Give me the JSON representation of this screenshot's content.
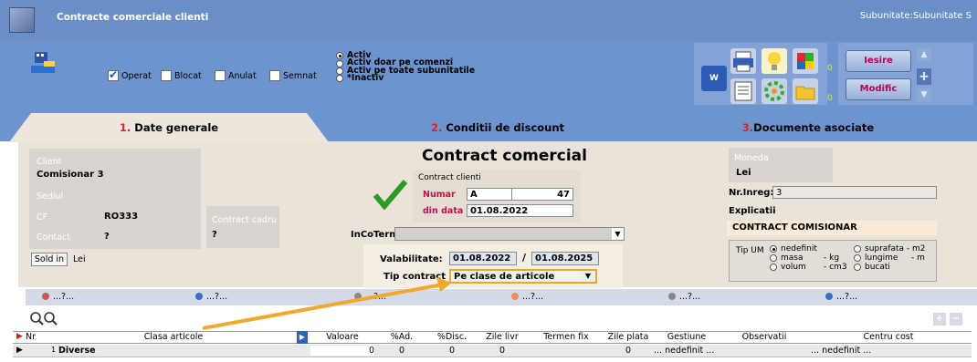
{
  "window": {
    "title": "Contracte comerciale clienti",
    "subunit": "Subunitate:Subunitate S"
  },
  "toolbar": {
    "checkboxes": [
      {
        "label": "Operat",
        "checked": true
      },
      {
        "label": "Blocat",
        "checked": false
      },
      {
        "label": "Anulat",
        "checked": false
      },
      {
        "label": "Semnat",
        "checked": false
      }
    ],
    "radios": [
      {
        "label": "Activ",
        "selected": true
      },
      {
        "label": "Activ doar pe comenzi",
        "selected": false
      },
      {
        "label": "Activ pe toate subunitatile",
        "selected": false
      },
      {
        "label": "*Inactiv",
        "selected": false
      }
    ],
    "counts": [
      "0",
      "0"
    ],
    "exit_label": "Iesire",
    "modify_label": "Modific"
  },
  "tabs": [
    {
      "num": "1.",
      "label": " Date generale"
    },
    {
      "num": "2.",
      "label": " Conditii de discount"
    },
    {
      "num": "3.",
      "label": "Documente asociate"
    }
  ],
  "client": {
    "client_label": "Client",
    "client_value": "Comisionar 3",
    "sediu_label": "Sediul",
    "cf_label": "CF",
    "cf_value": "RO333",
    "contract_cadru_label": "Contract cadru",
    "contract_cadru_value": "?",
    "contact_label": "Contact",
    "contact_value": "?",
    "sold_in_label": "Sold in",
    "sold_in_value": "Lei"
  },
  "contract": {
    "heading": "Contract comercial",
    "type": "Contract clienti",
    "numar_label": "Numar",
    "numar_series": "A",
    "numar_value": "47",
    "data_label": "din data",
    "data_value": "01.08.2022",
    "incoterms_label": "InCoTerms",
    "valabilitate_label": "Valabilitate:",
    "valid_from": "01.08.2022",
    "valid_to": "01.08.2025",
    "tip_label": "Tip contract",
    "tip_value": "Pe clase de articole"
  },
  "right": {
    "moneda_label": "Moneda",
    "moneda_value": "Lei",
    "nrinreg_label": "Nr.Inreg:",
    "nrinreg_value": "3",
    "explicatii_label": "Explicatii",
    "explicatii_value": "CONTRACT COMISIONAR",
    "tipum_label": "Tip UM",
    "um_options": [
      {
        "label": "nedefinit",
        "selected": true
      },
      {
        "label": "suprafata - m2",
        "selected": false
      },
      {
        "label": "masa",
        "unit": "- kg",
        "selected": false
      },
      {
        "label": "lungime",
        "unit": "- m",
        "selected": false
      },
      {
        "label": "volum",
        "unit": "- cm3",
        "selected": false
      },
      {
        "label": "bucati",
        "selected": false
      }
    ]
  },
  "strip_items": [
    "...?...",
    "...?...",
    "...?...",
    "...?...",
    "...?...",
    "...?..."
  ],
  "grid": {
    "headers": [
      "Nr",
      "Clasa articole",
      "Valoare",
      "%Ad.",
      "%Disc.",
      "Zile livr",
      "Termen fix",
      "Zile plata",
      "Gestiune",
      "Observatii",
      "Centru cost"
    ],
    "row": {
      "nr": "1",
      "clasa": "Diverse",
      "valoare": "0",
      "ad": "0",
      "disc": "0",
      "zile_livr": "0",
      "termen": "",
      "zile_plata": "0",
      "gestiune": "... nedefinit ...",
      "observatii": "",
      "centru": "... nedefinit ..."
    }
  }
}
